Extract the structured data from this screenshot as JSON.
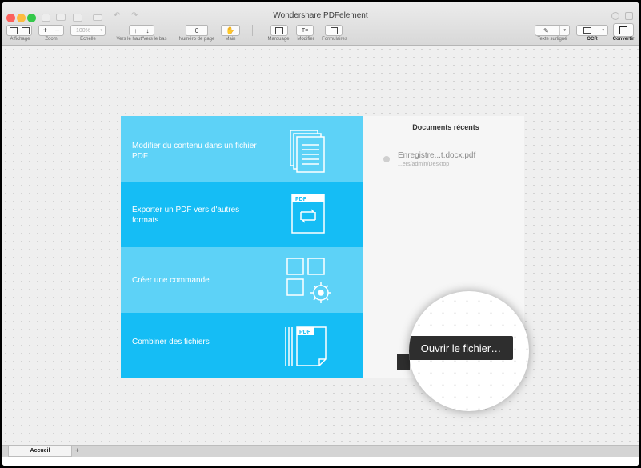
{
  "window": {
    "title": "Wondershare PDFelement"
  },
  "toolbar": {
    "zoom_value": "100%",
    "page_number": "0",
    "labels": {
      "affichage": "Affichage",
      "zoom": "Zoom",
      "echelle": "Echelle",
      "nav": "Vers le haut/Vers le bas",
      "page": "Numéro de page",
      "main": "Main",
      "marquage": "Marquage",
      "modifier": "Modifier",
      "formulaires": "Formulaires",
      "texte": "Texte surligné",
      "ocr": "OCR",
      "convertir": "Convertir"
    }
  },
  "actions": [
    {
      "label": "Modifier du contenu dans un fichier PDF",
      "color": "#5dd2f7",
      "icon": "pages-stack-icon"
    },
    {
      "label": "Exporter un PDF vers d'autres formats",
      "color": "#15bdf5",
      "icon": "pdf-convert-icon"
    },
    {
      "label": "Créer une commande",
      "color": "#5dd2f7",
      "icon": "grid-gear-icon"
    },
    {
      "label": "Combiner des fichiers",
      "color": "#15bdf5",
      "icon": "combine-pdf-icon"
    }
  ],
  "icons": {
    "pdf_tag": "PDF"
  },
  "recent": {
    "title": "Documents récents",
    "items": [
      {
        "name": "Enregistre...t.docx.pdf",
        "path": "...ers/admin/Desktop"
      }
    ]
  },
  "open_button": "Ouvrir le fichier…",
  "bottom": {
    "tab": "Accueil",
    "add": "+"
  },
  "colors": {
    "close": "#fc615d",
    "minimize": "#fdbc40",
    "zoom": "#34c84a"
  }
}
